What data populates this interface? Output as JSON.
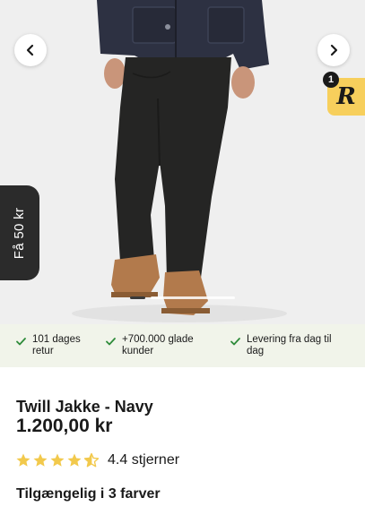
{
  "gallery": {
    "prev_icon": "chevron-left-icon",
    "next_icon": "chevron-right-icon",
    "image_count": 2,
    "active_image_index": 0
  },
  "reward_badge": {
    "letter": "R",
    "count": "1",
    "color": "#f7cf5c"
  },
  "side_tab": {
    "label": "Få 50 kr"
  },
  "usps": [
    {
      "icon": "check-icon",
      "text_line1": "101 dages",
      "text_line2": "retur"
    },
    {
      "icon": "check-icon",
      "text_line1": "+700.000 glade",
      "text_line2": "kunder"
    },
    {
      "icon": "check-icon",
      "text_line1": "Levering fra dag til",
      "text_line2": "dag"
    }
  ],
  "product": {
    "title": "Twill Jakke - Navy",
    "price": "1.200,00 kr",
    "rating_value": 4.4,
    "rating_text": "4.4 stjerner",
    "colors_heading": "Tilgængelig i 3 farver"
  },
  "colors": {
    "accent_green": "#2e8b3a",
    "usp_background": "#f1f4ea",
    "star_yellow": "#f2c94c",
    "jacket_navy": "#2d3142"
  }
}
